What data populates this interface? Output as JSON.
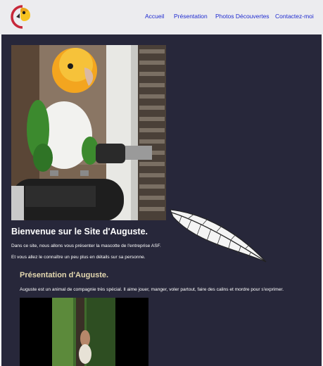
{
  "nav": {
    "items": [
      {
        "label": "Accueil"
      },
      {
        "label": "Présentation"
      },
      {
        "label": "Photos Découvertes"
      },
      {
        "label": "Contactez-moi"
      }
    ]
  },
  "welcome": {
    "title": "Bienvenue sur le Site d'Auguste.",
    "line1": "Dans ce site, nous allons vous présenter la mascotte de l'entreprise ASF.",
    "line2": "Et vous allez le connaître un peu plus en détails sur sa personne."
  },
  "presentation": {
    "title": "Présentation d'Auguste.",
    "text": "Auguste est un animal de compagnie très spécial. Il aime jouer, manger, voler partout, faire des calins et mordre pour s'exprimer."
  },
  "colors": {
    "header_bg": "#ececef",
    "page_bg": "#27273a",
    "nav_link": "#1f2bd0",
    "section_title": "#e4d8b0"
  },
  "icons": {
    "logo": "parrot-logo-icon",
    "decoration": "feather-icon"
  }
}
